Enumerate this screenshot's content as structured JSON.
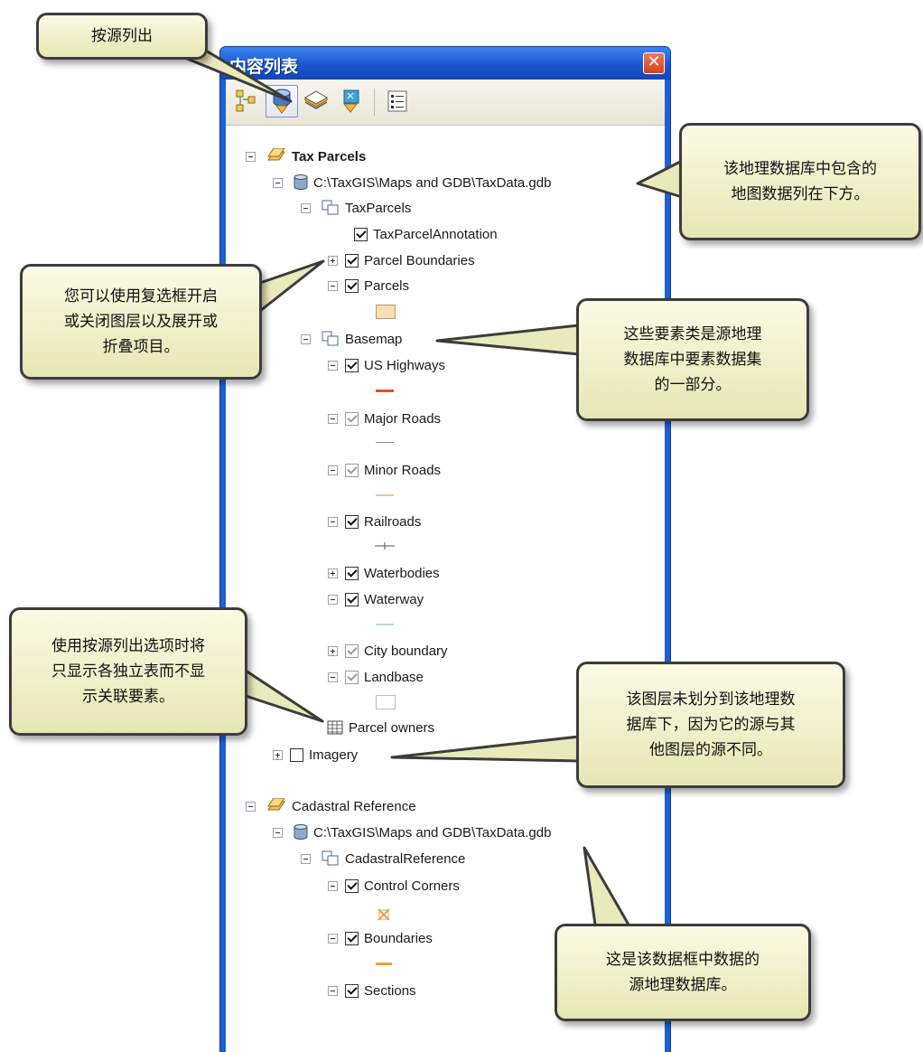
{
  "window": {
    "title": "内容列表",
    "close_label": "✕"
  },
  "toolbar": {
    "buttons": [
      "list-by-drawing-order-icon",
      "list-by-source-icon",
      "list-by-visibility-icon",
      "list-by-selection-icon",
      "options-icon"
    ]
  },
  "tree": {
    "tax_parcels": "Tax Parcels",
    "tax_gdb": "C:\\TaxGIS\\Maps and GDB\\TaxData.gdb",
    "taxparcels_dataset": "TaxParcels",
    "annotation": "TaxParcelAnnotation",
    "parcel_boundaries": "Parcel Boundaries",
    "parcels": "Parcels",
    "basemap": "Basemap",
    "us_highways": "US Highways",
    "major_roads": "Major Roads",
    "minor_roads": "Minor Roads",
    "railroads": "Railroads",
    "waterbodies": "Waterbodies",
    "waterway": "Waterway",
    "city_boundary": "City boundary",
    "landbase": "Landbase",
    "parcel_owners": "Parcel owners",
    "imagery": "Imagery",
    "cadastral_reference": "Cadastral Reference",
    "cadastral_gdb": "C:\\TaxGIS\\Maps and GDB\\TaxData.gdb",
    "cadastral_dataset": "CadastralReference",
    "control_corners": "Control Corners",
    "boundaries": "Boundaries",
    "sections": "Sections"
  },
  "callouts": {
    "list_by_source": "按源列出",
    "gdb_contents": "该地理数据库中包含的\n地图数据列在下方。",
    "checkbox_tip": "您可以使用复选框开启\n或关闭图层以及展开或\n折叠项目。",
    "feature_classes": "这些要素类是源地理\n数据库中要素数据集\n的一部分。",
    "tables_tip": "使用按源列出选项时将\n只显示各独立表而不显\n示关联要素。",
    "different_source": "该图层未划分到该地理数\n据库下，因为它的源与其\n他图层的源不同。",
    "source_gdb": "这是该数据框中数据的\n源地理数据库。"
  },
  "colors": {
    "titlebar": "#1f5fd4",
    "callout_fill": "#f3f3cf",
    "highway": "#e0502a",
    "minor_road": "#e8c79a",
    "waterway": "#b8d6ef",
    "parcel_fill": "#f6dfb2"
  }
}
